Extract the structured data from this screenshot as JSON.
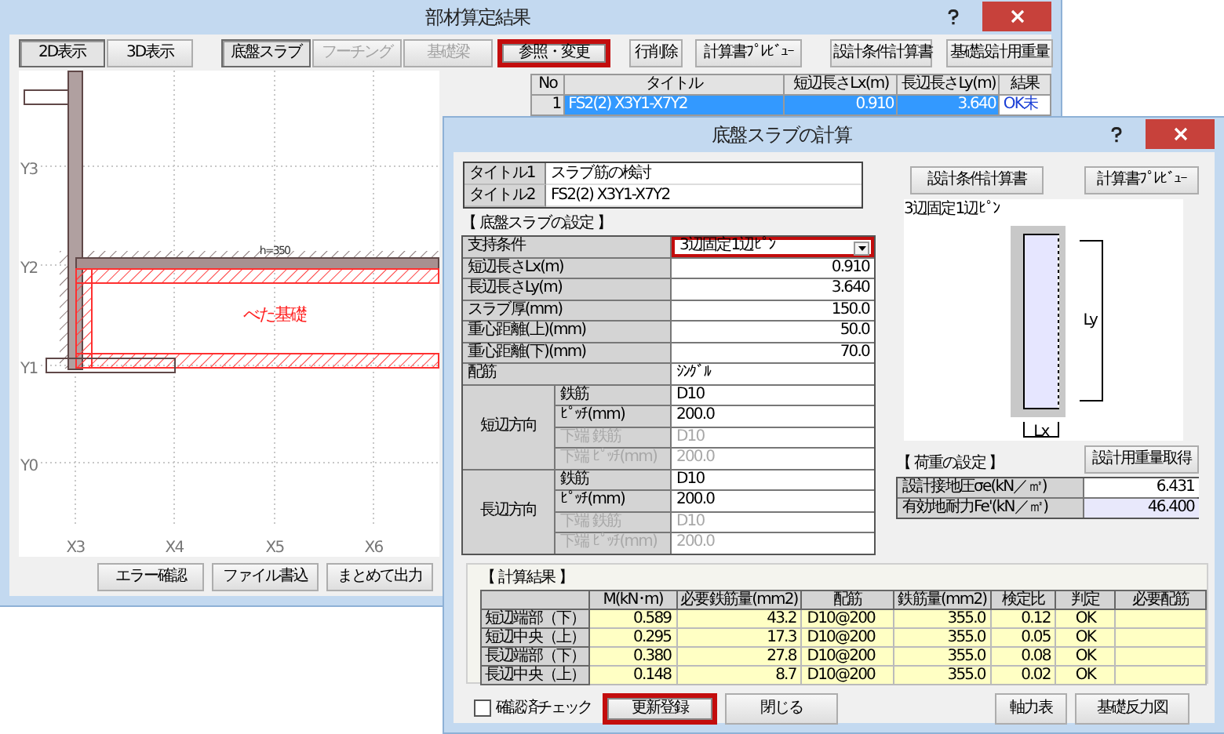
{
  "back_window": {
    "title": "部材算定結果",
    "view_buttons": [
      {
        "label": "2D表示",
        "selected": true
      },
      {
        "label": "3D表示",
        "selected": false
      }
    ],
    "member_tabs": [
      {
        "label": "底盤スラブ",
        "selected": true,
        "disabled": false
      },
      {
        "label": "フーチング",
        "selected": false,
        "disabled": true
      },
      {
        "label": "基礎梁",
        "selected": false,
        "disabled": true
      }
    ],
    "action_buttons": [
      {
        "label": "参照・変更",
        "highlighted": true
      },
      {
        "label": "行削除",
        "highlighted": false
      },
      {
        "label": "計算書ﾌﾟﾚﾋﾞｭｰ",
        "highlighted": false
      },
      {
        "label": "設計条件計算書",
        "highlighted": false
      },
      {
        "label": "基礎設計用重量",
        "highlighted": false
      }
    ],
    "table": {
      "columns": [
        "No",
        "タイトル",
        "短辺長さLx(m)",
        "長辺長さLy(m)",
        "結果"
      ],
      "rows": [
        {
          "cells": [
            "1",
            "FS2(2) X3Y1-X7Y2",
            "0.910",
            "3.640",
            "OK未"
          ],
          "selected": true
        }
      ]
    },
    "drawing": {
      "y_axes": [
        "Y3",
        "Y2",
        "Y1",
        "Y0"
      ],
      "x_axes": [
        "X3",
        "X4",
        "X5",
        "X6"
      ],
      "region_label": "べた基礎",
      "dimension_label": "h=350"
    },
    "bottom_buttons": [
      "エラー確認",
      "ファイル書込",
      "まとめて出力"
    ]
  },
  "dialog": {
    "title": "底盤スラブの計算",
    "titles": [
      {
        "label": "タイトル1",
        "value": "スラブ筋の検討"
      },
      {
        "label": "タイトル2",
        "value": "FS2(2) X3Y1-X7Y2"
      }
    ],
    "settings_heading": "【 底盤スラブの設定 】",
    "settings": [
      {
        "kind": "dropdown",
        "label": "支持条件",
        "value": "3辺固定1辺ﾋﾟﾝ",
        "highlighted": true
      },
      {
        "kind": "number",
        "label": "短辺長さLx(m)",
        "value": "0.910"
      },
      {
        "kind": "number",
        "label": "長辺長さLy(m)",
        "value": "3.640"
      },
      {
        "kind": "number",
        "label": "スラブ厚(mm)",
        "value": "150.0"
      },
      {
        "kind": "number",
        "label": "重心距離(上)(mm)",
        "value": "50.0"
      },
      {
        "kind": "number",
        "label": "重心距離(下)(mm)",
        "value": "70.0"
      },
      {
        "kind": "text",
        "label": "配筋",
        "value": "ｼﾝｸﾞﾙ"
      }
    ],
    "directions": [
      {
        "label": "短辺方向",
        "rows": [
          {
            "label": "鉄筋",
            "value": "D10",
            "disabled": false
          },
          {
            "label": "ﾋﾟｯﾁ(mm)",
            "value": "200.0",
            "disabled": false
          },
          {
            "label": "下端 鉄筋",
            "value": "D10",
            "disabled": true
          },
          {
            "label": "下端 ﾋﾟｯﾁ(mm)",
            "value": "200.0",
            "disabled": true
          }
        ]
      },
      {
        "label": "長辺方向",
        "rows": [
          {
            "label": "鉄筋",
            "value": "D10",
            "disabled": false
          },
          {
            "label": "ﾋﾟｯﾁ(mm)",
            "value": "200.0",
            "disabled": false
          },
          {
            "label": "下端 鉄筋",
            "value": "D10",
            "disabled": true
          },
          {
            "label": "下端 ﾋﾟｯﾁ(mm)",
            "value": "200.0",
            "disabled": true
          }
        ]
      }
    ],
    "top_buttons": [
      "設計条件計算書",
      "計算書ﾌﾟﾚﾋﾞｭｰ"
    ],
    "diagram": {
      "caption": "3辺固定1辺ﾋﾟﾝ",
      "ly_label": "Ly",
      "lx_label": "Lx"
    },
    "load_heading": "【 荷重の設定 】",
    "load_button": "設計用重量取得",
    "loads": [
      {
        "label": "設計接地圧σe(kN／㎡)",
        "value": "6.431",
        "readonly": false
      },
      {
        "label": "有効地耐力Fe'(kN／㎡)",
        "value": "46.400",
        "readonly": true
      }
    ],
    "results_heading": "【 計算結果 】",
    "results": {
      "columns": [
        "M(kN･m)",
        "必要鉄筋量(mm2)",
        "配筋",
        "鉄筋量(mm2)",
        "検定比",
        "判定",
        "必要配筋"
      ],
      "rows": [
        {
          "label": "短辺端部（下）",
          "cells": [
            "0.589",
            "43.2",
            "D10@200",
            "355.0",
            "0.12",
            "OK"
          ]
        },
        {
          "label": "短辺中央（上）",
          "cells": [
            "0.295",
            "17.3",
            "D10@200",
            "355.0",
            "0.05",
            "OK"
          ]
        },
        {
          "label": "長辺端部（下）",
          "cells": [
            "0.380",
            "27.8",
            "D10@200",
            "355.0",
            "0.08",
            "OK"
          ]
        },
        {
          "label": "長辺中央（上）",
          "cells": [
            "0.148",
            "8.7",
            "D10@200",
            "355.0",
            "0.02",
            "OK"
          ]
        }
      ]
    },
    "confirm_check": {
      "label": "確認済チェック",
      "checked": false
    },
    "footer_buttons": [
      {
        "label": "更新登録",
        "highlighted": true
      },
      {
        "label": "閉じる",
        "highlighted": false
      },
      {
        "label": "軸力表",
        "highlighted": false
      },
      {
        "label": "基礎反力図",
        "highlighted": false
      }
    ]
  }
}
